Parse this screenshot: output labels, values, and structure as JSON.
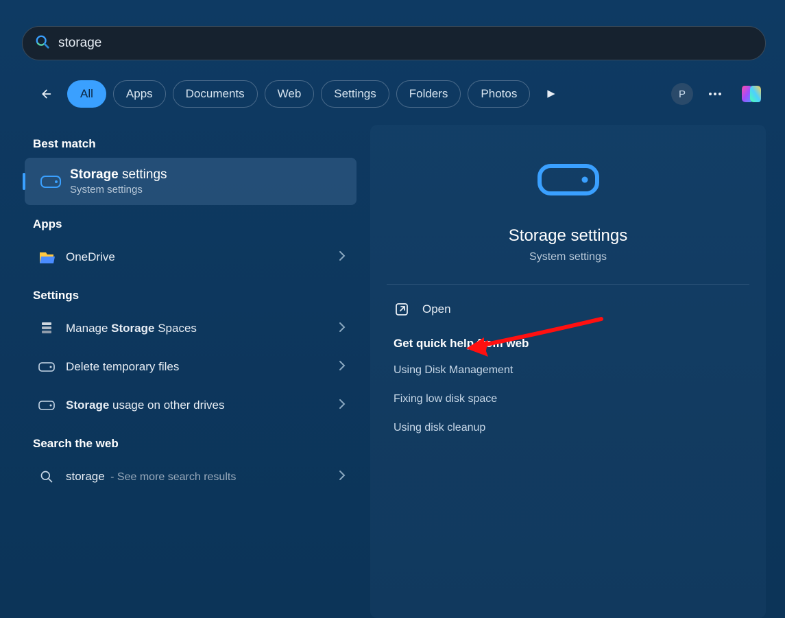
{
  "search": {
    "value": "storage"
  },
  "filters": {
    "all": "All",
    "apps": "Apps",
    "documents": "Documents",
    "web": "Web",
    "settings": "Settings",
    "folders": "Folders",
    "photos": "Photos"
  },
  "header_right": {
    "avatar_letter": "P"
  },
  "sections": {
    "best_match": "Best match",
    "apps": "Apps",
    "settings": "Settings",
    "search_web": "Search the web"
  },
  "best_match": {
    "title_bold": "Storage",
    "title_rest": " settings",
    "subtitle": "System settings"
  },
  "apps_list": [
    {
      "label": "OneDrive"
    }
  ],
  "settings_list": [
    {
      "pre": "Manage ",
      "bold": "Storage",
      "post": " Spaces",
      "icon": "stack"
    },
    {
      "pre": "Delete temporary files",
      "bold": "",
      "post": "",
      "icon": "chip"
    },
    {
      "pre": "",
      "bold": "Storage",
      "post": " usage on other drives",
      "icon": "chip"
    }
  ],
  "web_list": [
    {
      "term": "storage",
      "suffix": " - See more search results"
    }
  ],
  "detail": {
    "title": "Storage settings",
    "subtitle": "System settings",
    "open": "Open",
    "help_header": "Get quick help from web",
    "links": [
      "Using Disk Management",
      "Fixing low disk space",
      "Using disk cleanup"
    ]
  }
}
